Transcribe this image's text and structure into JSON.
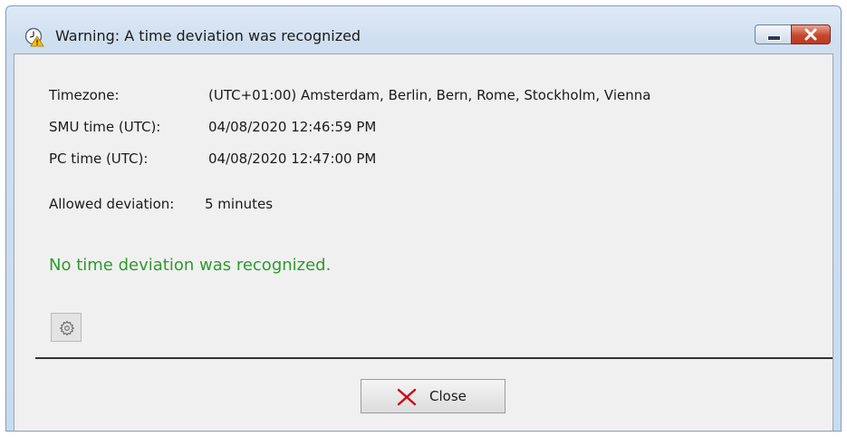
{
  "window": {
    "title": "Warning: A time deviation was recognized",
    "icons": {
      "title": "clock-warning-icon",
      "minimize": "minimize-icon",
      "close": "close-icon"
    }
  },
  "info": {
    "timezone": {
      "label": "Timezone:",
      "value": "(UTC+01:00) Amsterdam, Berlin, Bern, Rome, Stockholm, Vienna"
    },
    "smu_time": {
      "label": "SMU time (UTC):",
      "value": "04/08/2020 12:46:59 PM"
    },
    "pc_time": {
      "label": "PC time (UTC):",
      "value": "04/08/2020 12:47:00 PM"
    },
    "allowed_deviation": {
      "label": "Allowed deviation:",
      "value": "5 minutes"
    }
  },
  "status": {
    "message": "No time deviation was recognized.",
    "color": "#2e9a2e"
  },
  "settings": {
    "icon": "gear-icon"
  },
  "footer": {
    "close_label": "Close",
    "close_icon": "red-x-icon",
    "close_icon_color": "#d0021b"
  }
}
